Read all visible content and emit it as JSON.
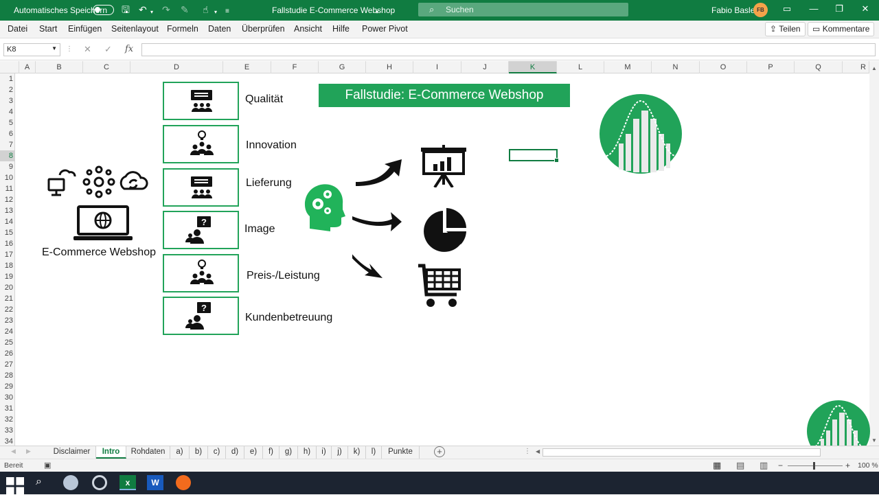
{
  "titlebar": {
    "autosave_label": "Automatisches Speichern",
    "doc_title": "Fallstudie E-Commerce Webshop",
    "search_placeholder": "Suchen",
    "user_name": "Fabio Basler",
    "user_initials": "FB"
  },
  "menu": {
    "items": [
      "Datei",
      "Start",
      "Einfügen",
      "Seitenlayout",
      "Formeln",
      "Daten",
      "Überprüfen",
      "Ansicht",
      "Hilfe",
      "Power Pivot"
    ],
    "share_label": "Teilen",
    "comments_label": "Kommentare"
  },
  "formula_bar": {
    "name_box": "K8",
    "fx_label": "fx",
    "formula": ""
  },
  "columns": [
    "A",
    "B",
    "C",
    "D",
    "E",
    "F",
    "G",
    "H",
    "I",
    "J",
    "K",
    "L",
    "M",
    "N",
    "O",
    "P",
    "Q",
    "R"
  ],
  "selected_column": "K",
  "rows": [
    "1",
    "2",
    "3",
    "4",
    "5",
    "6",
    "7",
    "8",
    "9",
    "10",
    "11",
    "12",
    "13",
    "14",
    "15",
    "16",
    "17",
    "18",
    "19",
    "20",
    "21",
    "22",
    "23",
    "24",
    "25",
    "26",
    "27",
    "28",
    "29",
    "30",
    "31",
    "32",
    "33",
    "34"
  ],
  "selected_row": "8",
  "sheet": {
    "banner": "Fallstudie: E-Commerce Webshop",
    "webshop_label": "E-Commerce Webshop",
    "categories": [
      "Qualität",
      "Innovation",
      "Lieferung",
      "Image",
      "Preis-/Leistung",
      "Kundenbetreuung"
    ],
    "accent_color": "#21a359"
  },
  "tabs": [
    "Disclaimer",
    "Intro",
    "Rohdaten",
    "a)",
    "b)",
    "c)",
    "d)",
    "e)",
    "f)",
    "g)",
    "h)",
    "i)",
    "j)",
    "k)",
    "l)",
    "Punkte"
  ],
  "active_tab": "Intro",
  "status": {
    "ready": "Bereit",
    "zoom": "100 %"
  }
}
